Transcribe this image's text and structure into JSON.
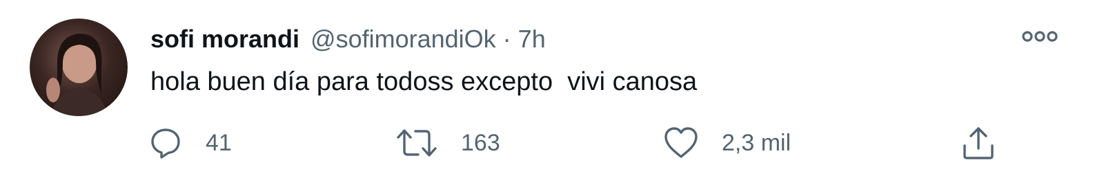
{
  "tweet": {
    "display_name": "sofi morandi",
    "handle": "@sofimorandiOk",
    "separator": "·",
    "timestamp": "7h",
    "text": "hola buen día para todoss excepto  vivi canosa"
  },
  "actions": {
    "reply": {
      "icon": "reply-icon",
      "count": "41"
    },
    "retweet": {
      "icon": "retweet-icon",
      "count": "163"
    },
    "like": {
      "icon": "heart-icon",
      "count": "2,3 mil"
    },
    "share": {
      "icon": "share-icon"
    }
  },
  "colors": {
    "primary_text": "#0f1419",
    "secondary_text": "#536471",
    "background": "#ffffff"
  }
}
